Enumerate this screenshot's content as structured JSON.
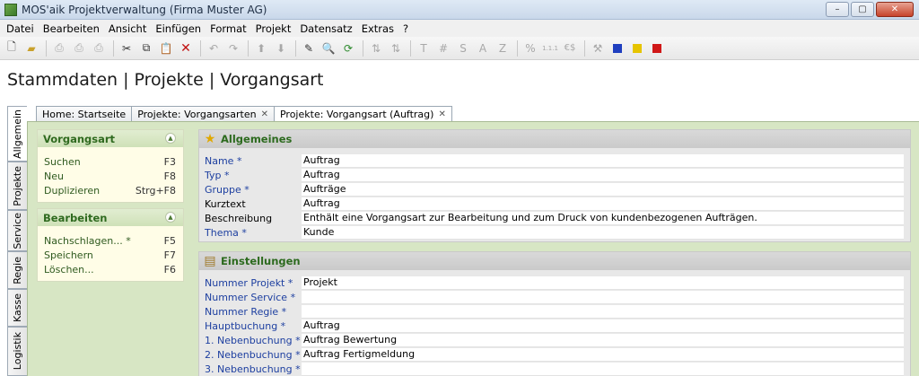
{
  "window": {
    "title": "MOS'aik Projektverwaltung (Firma Muster AG)"
  },
  "menu": [
    "Datei",
    "Bearbeiten",
    "Ansicht",
    "Einfügen",
    "Format",
    "Projekt",
    "Datensatz",
    "Extras",
    "?"
  ],
  "toolbar": {
    "letters": [
      "T",
      "#",
      "S",
      "A",
      "Z"
    ],
    "percent": "%",
    "numbering": "1.1.1",
    "currency": "€$"
  },
  "page": {
    "title": "Stammdaten | Projekte | Vorgangsart"
  },
  "side_tabs": [
    "Allgemein",
    "Projekte",
    "Service",
    "Regie",
    "Kasse",
    "Logistik"
  ],
  "tabs": [
    {
      "label": "Home: Startseite"
    },
    {
      "label": "Projekte: Vorgangsarten"
    },
    {
      "label": "Projekte: Vorgangsart (Auftrag)"
    }
  ],
  "panels": {
    "vorgangsart": {
      "title": "Vorgangsart",
      "items": [
        {
          "label": "Suchen",
          "key": "F3"
        },
        {
          "label": "Neu",
          "key": "F8"
        },
        {
          "label": "Duplizieren",
          "key": "Strg+F8"
        }
      ]
    },
    "bearbeiten": {
      "title": "Bearbeiten",
      "items": [
        {
          "label": "Nachschlagen... *",
          "key": "F5"
        },
        {
          "label": "Speichern",
          "key": "F7"
        },
        {
          "label": "Löschen...",
          "key": "F6"
        }
      ]
    }
  },
  "allgemeines": {
    "title": "Allgemeines",
    "fields": [
      {
        "label": "Name *",
        "value": "Auftrag"
      },
      {
        "label": "Typ *",
        "value": "Auftrag"
      },
      {
        "label": "Gruppe *",
        "value": "Aufträge"
      },
      {
        "label": "Kurztext",
        "value": "Auftrag"
      },
      {
        "label": "Beschreibung",
        "value": "Enthält eine Vorgangsart zur Bearbeitung und zum Druck von kundenbezogenen Aufträgen."
      },
      {
        "label": "Thema *",
        "value": "Kunde"
      }
    ]
  },
  "einstellungen": {
    "title": "Einstellungen",
    "fields": [
      {
        "label": "Nummer Projekt *",
        "value": "Projekt"
      },
      {
        "label": "Nummer Service *",
        "value": ""
      },
      {
        "label": "Nummer Regie *",
        "value": ""
      },
      {
        "label": "Hauptbuchung *",
        "value": "Auftrag"
      },
      {
        "label": "1. Nebenbuchung *",
        "value": "Auftrag Bewertung"
      },
      {
        "label": "2. Nebenbuchung *",
        "value": "Auftrag Fertigmeldung"
      },
      {
        "label": "3. Nebenbuchung *",
        "value": ""
      }
    ]
  },
  "colors": {
    "accent_green": "#2f6a1f",
    "label_blue": "#1d3fa0",
    "content_bg": "#d7e6c4"
  }
}
